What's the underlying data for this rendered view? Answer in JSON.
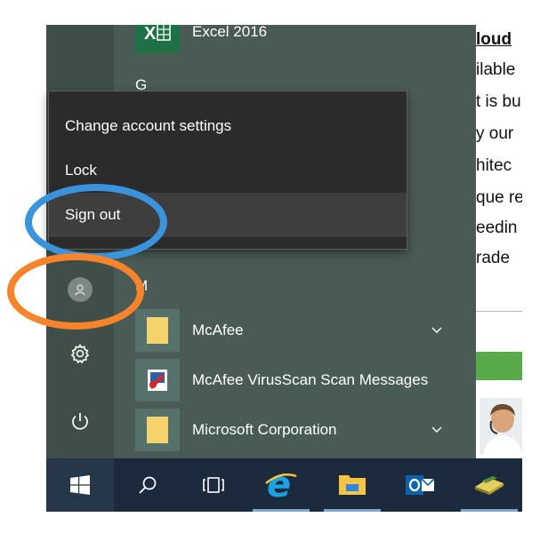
{
  "webpage": {
    "lines": [
      "loud",
      "ilable",
      "t is bu",
      "y our",
      "hitec",
      "que re",
      "eedin",
      "rade"
    ]
  },
  "start_menu": {
    "apps_top": [
      {
        "label": "Excel 2016",
        "icon": "excel-icon"
      }
    ],
    "letters": [
      "G",
      "M"
    ],
    "apps_m": [
      {
        "label": "McAfee",
        "icon": "folder-icon",
        "expandable": true
      },
      {
        "label": "McAfee VirusScan Scan Messages",
        "icon": "mcafee-virusscan-icon",
        "expandable": false
      },
      {
        "label": "Microsoft Corporation",
        "icon": "folder-icon",
        "expandable": true
      }
    ],
    "rail_icons": [
      "user-avatar-icon",
      "settings-gear-icon",
      "power-icon"
    ]
  },
  "account_flyout": {
    "items": [
      "Change account settings",
      "Lock",
      "Sign out"
    ],
    "hovered_item": "Sign out"
  },
  "taskbar": {
    "icons": [
      "windows-start-icon",
      "search-icon",
      "task-view-icon",
      "internet-explorer-icon",
      "file-explorer-icon",
      "outlook-icon",
      "app-icon"
    ]
  },
  "colors": {
    "start_bg": "#4a5b55",
    "rail_bg": "#3f4e49",
    "flyout_bg": "#2b2b2b",
    "taskbar_bg": "#1b2a3c",
    "tile_accent": "#56716c",
    "folder_yellow": "#f4d36b",
    "annotation_blue": "#3a93dd",
    "annotation_orange": "#f7842a"
  }
}
